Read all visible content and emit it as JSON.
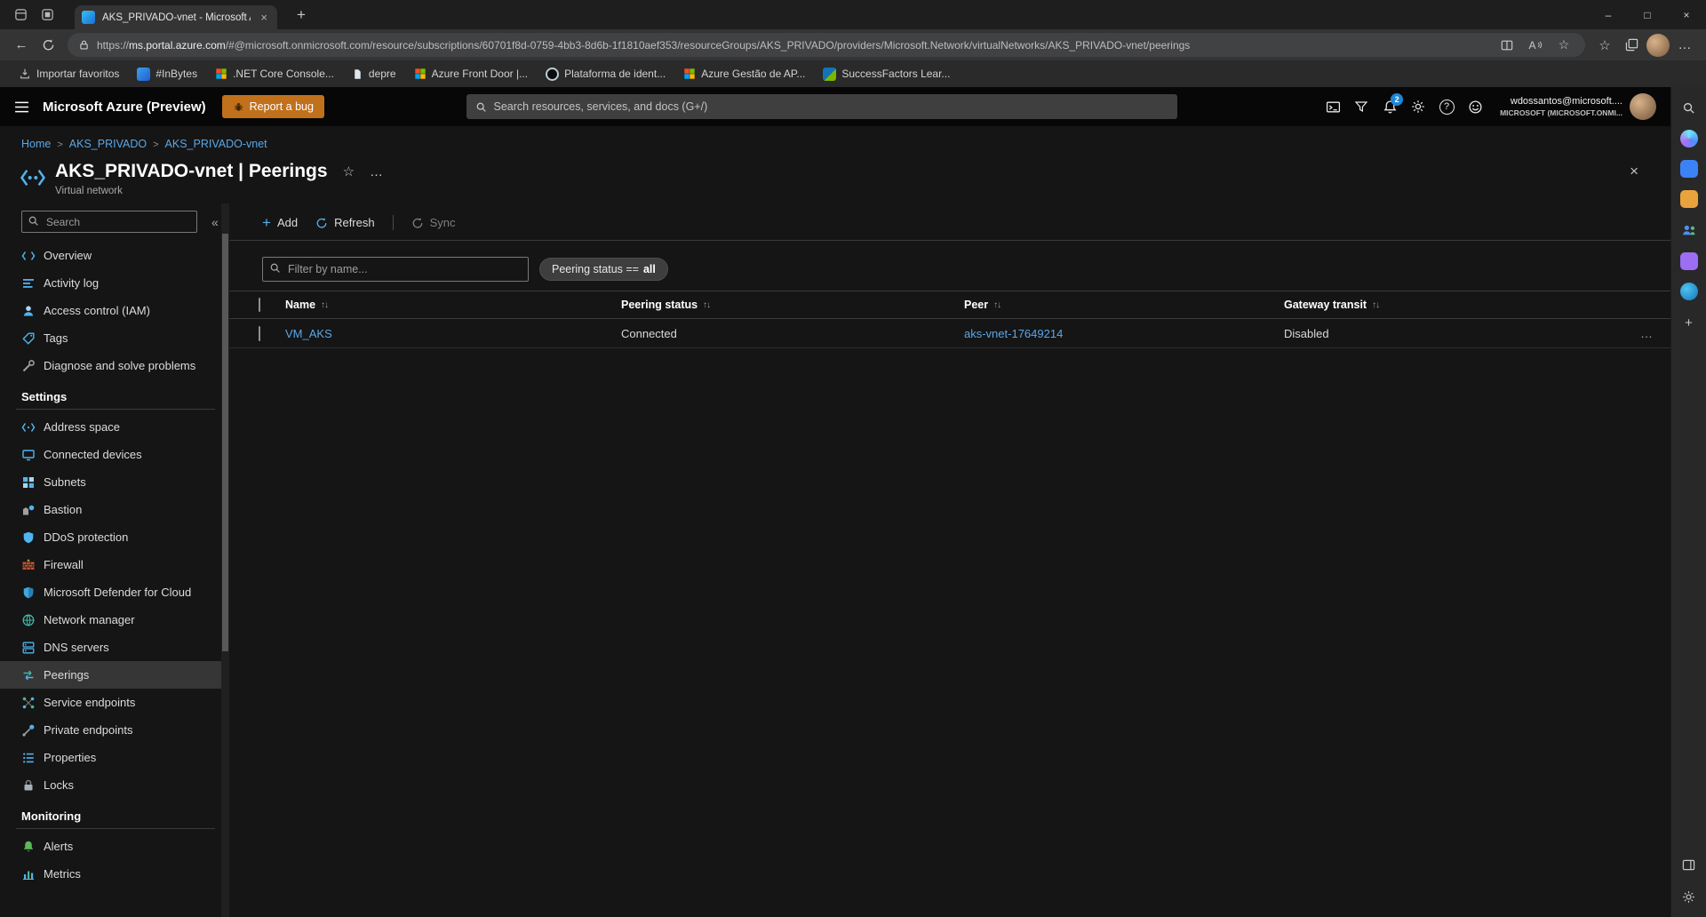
{
  "glyphs": {
    "back": "←",
    "plus": "+",
    "close": "×",
    "minimize": "–",
    "maximize": "□",
    "star": "☆",
    "more": "…",
    "collapse": "«",
    "sort": "↑↓",
    "help": "?",
    "readaloud": "A"
  },
  "browser": {
    "tab_title": "AKS_PRIVADO-vnet - Microsoft A...",
    "url_scheme": "https://",
    "url_host": "ms.portal.azure.com",
    "url_path": "/#@microsoft.onmicrosoft.com/resource/subscriptions/60701f8d-0759-4bb3-8d6b-1f1810aef353/resourceGroups/AKS_PRIVADO/providers/Microsoft.Network/virtualNetworks/AKS_PRIVADO-vnet/peerings",
    "favorites": [
      "Importar favoritos",
      "#InBytes",
      ".NET Core Console...",
      "depre",
      "Azure Front Door |...",
      "Plataforma de ident...",
      "Azure Gestão de AP...",
      "SuccessFactors Lear..."
    ]
  },
  "topbar": {
    "brand": "Microsoft Azure (Preview)",
    "report_bug": "Report a bug",
    "search_placeholder": "Search resources, services, and docs (G+/)",
    "notifications_badge": "2",
    "user_name": "wdossantos@microsoft....",
    "user_tenant": "MICROSOFT (MICROSOFT.ONMI..."
  },
  "breadcrumb": {
    "separator": ">",
    "items": [
      "Home",
      "AKS_PRIVADO",
      "AKS_PRIVADO-vnet"
    ]
  },
  "blade": {
    "title": "AKS_PRIVADO-vnet | Peerings",
    "subtitle": "Virtual network"
  },
  "sidebar": {
    "search_placeholder": "Search",
    "groups": [
      {
        "header": "",
        "items": [
          "Overview",
          "Activity log",
          "Access control (IAM)",
          "Tags",
          "Diagnose and solve problems"
        ]
      },
      {
        "header": "Settings",
        "items": [
          "Address space",
          "Connected devices",
          "Subnets",
          "Bastion",
          "DDoS protection",
          "Firewall",
          "Microsoft Defender for Cloud",
          "Network manager",
          "DNS servers",
          "Peerings",
          "Service endpoints",
          "Private endpoints",
          "Properties",
          "Locks"
        ]
      },
      {
        "header": "Monitoring",
        "items": [
          "Alerts",
          "Metrics"
        ]
      }
    ]
  },
  "commandbar": {
    "add": "Add",
    "refresh": "Refresh",
    "sync": "Sync"
  },
  "filterbar": {
    "search_placeholder": "Filter by name...",
    "pill_label": "Peering status ==",
    "pill_value": "all"
  },
  "table": {
    "columns": [
      "Name",
      "Peering status",
      "Peer",
      "Gateway transit"
    ],
    "rows": [
      {
        "name": "VM_AKS",
        "peering_status": "Connected",
        "peer": "aks-vnet-17649214",
        "gateway_transit": "Disabled"
      }
    ]
  },
  "colors": {
    "accent_link": "#5aa7e8",
    "command_accent": "#4fb4f0",
    "report_bug_bg": "#c1701c",
    "badge_bg": "#1f86d6",
    "selected_item_bg": "#363636"
  }
}
